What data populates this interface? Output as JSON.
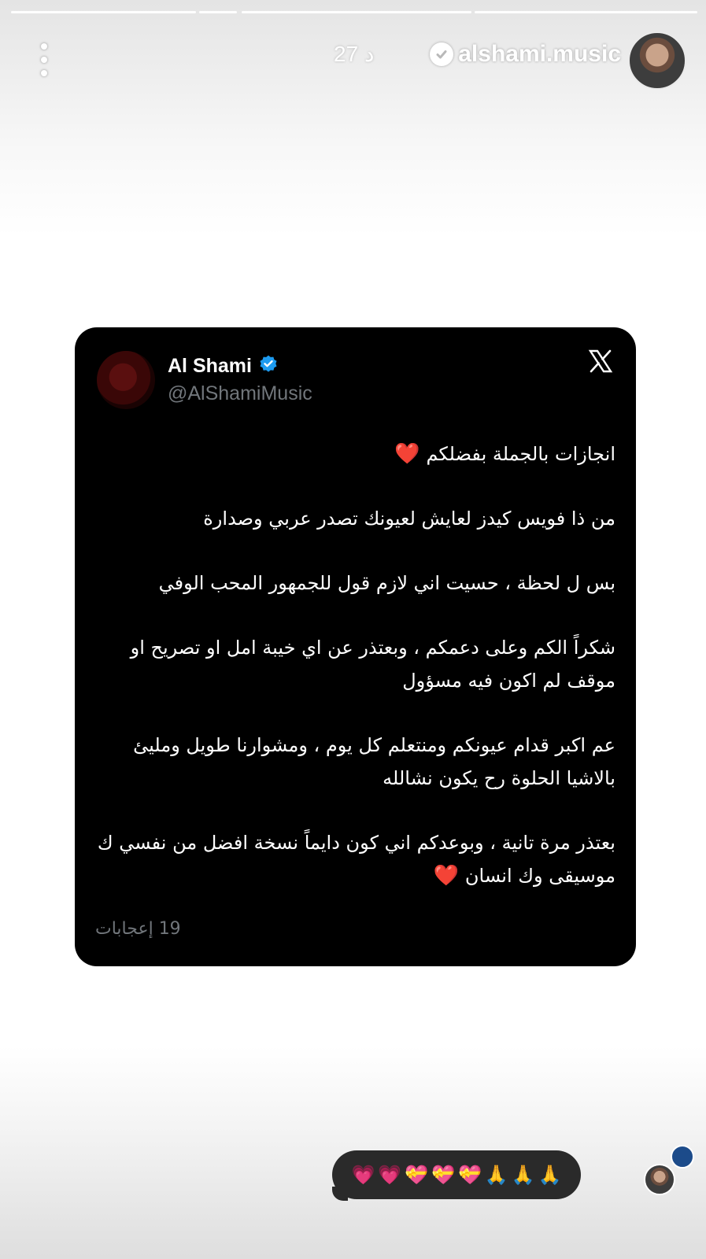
{
  "story": {
    "progress_segments": 4,
    "username": "alshami.music",
    "time_ago": "27 د",
    "more_icon": "more-vertical-icon"
  },
  "tweet": {
    "name": "Al Shami",
    "handle": "@AlShamiMusic",
    "platform_icon": "x-logo-icon",
    "paragraphs": [
      "انجازات بالجملة بفضلكم",
      "من ذا فويس كيدز لعايش لعيونك تصدر عربي وصدارة",
      "بس ل لحظة ، حسيت اني لازم قول للجمهور المحب الوفي",
      "شكراً الكم وعلى دعمكم ، وبعتذر عن اي خيبة امل او تصريح او موقف لم اكون فيه مسؤول",
      "عم اكبر قدام عيونكم ومنتعلم كل يوم ، ومشوارنا طويل ومليئ بالاشيا الحلوة رح يكون نشالله",
      "بعتذر مرة تانية  ، وبوعدكم اني كون دايماً نسخة افضل من نفسي ك موسيقى وك انسان"
    ],
    "heart_emoji": "❤️",
    "likes": "19 إعجابات"
  },
  "reply": {
    "emojis": [
      "💗",
      "💗",
      "💝",
      "💝",
      "💝",
      "🙏",
      "🙏",
      "🙏"
    ]
  },
  "colors": {
    "card_bg": "#000000",
    "verified_blue": "#1d9bf0",
    "muted_text": "#71767b",
    "heart": "#e0312f",
    "reply_bg": "#2a2a2a"
  }
}
